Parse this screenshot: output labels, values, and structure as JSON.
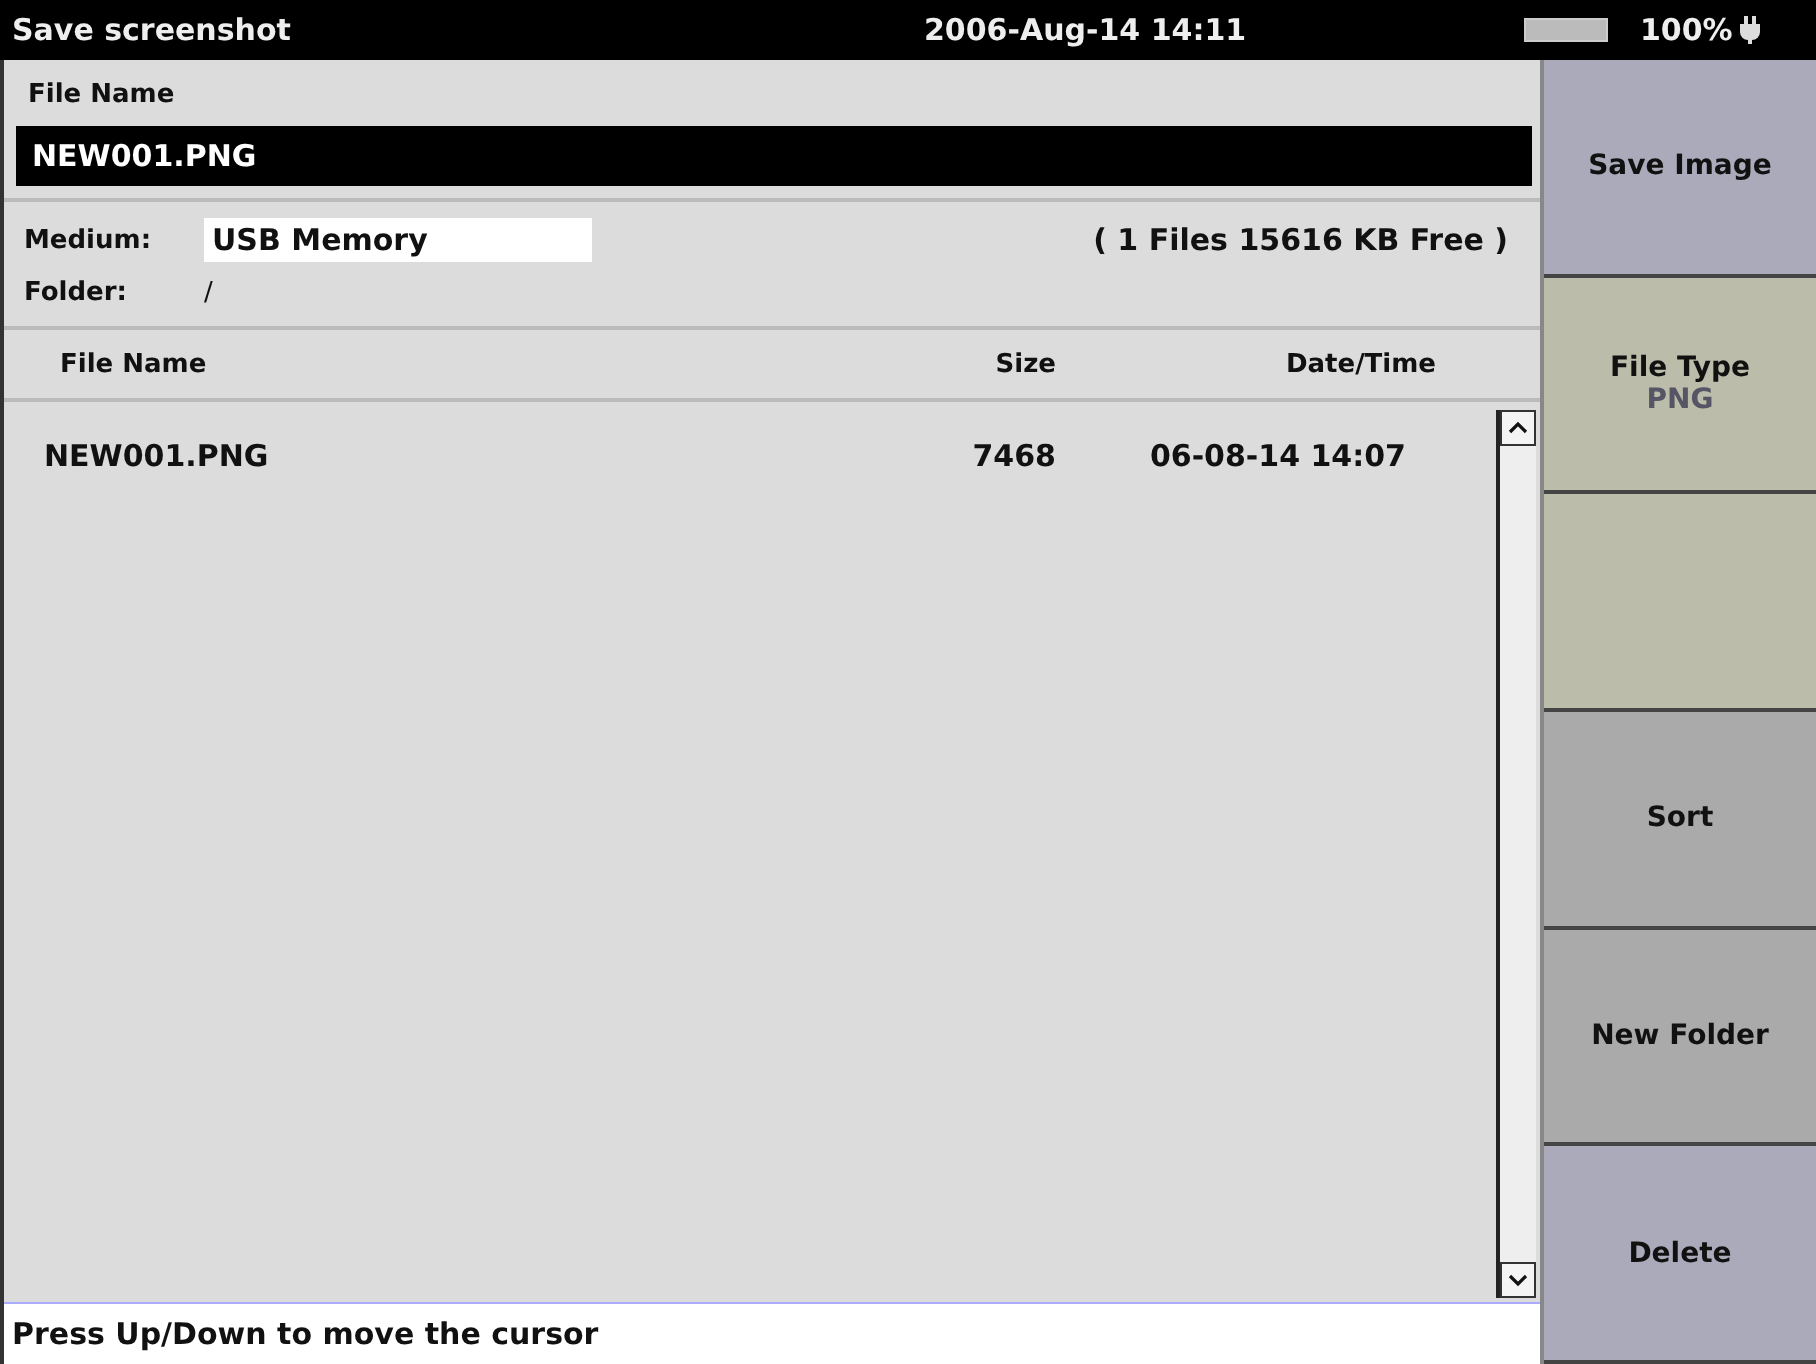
{
  "title_bar": {
    "title": "Save screenshot",
    "datetime": "2006-Aug-14 14:11",
    "battery_text": "100%"
  },
  "file_name": {
    "label": "File Name",
    "value": "NEW001.PNG"
  },
  "medium": {
    "label": "Medium:",
    "value": "USB Memory",
    "summary": "( 1 Files   15616 KB Free )"
  },
  "folder": {
    "label": "Folder:",
    "value": "/"
  },
  "table": {
    "columns": [
      "File Name",
      "Size",
      "Date/Time"
    ],
    "rows": [
      {
        "cells": [
          "NEW001.PNG",
          "7468",
          "06-08-14 14:07"
        ],
        "selected": false
      }
    ]
  },
  "status_bar": "Press Up/Down to move the cursor",
  "softkeys": [
    {
      "label": "Save Image",
      "color": "#aaaabb"
    },
    {
      "label": "File Type",
      "value": "PNG",
      "color": "#bcbcaa"
    },
    {
      "color": "#bcbcaa"
    },
    {
      "label": "Sort",
      "color": "#aaaaaa"
    },
    {
      "label": "New Folder",
      "color": "#aaaaaa"
    },
    {
      "label": "Delete",
      "color": "#aaaabb"
    }
  ]
}
